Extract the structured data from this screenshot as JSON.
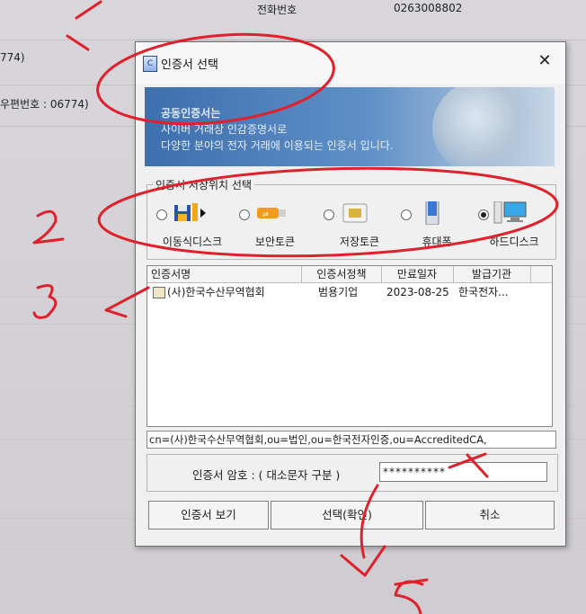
{
  "background": {
    "phone_label": "전화번호",
    "phone_value": "0263008802",
    "left_text_1": "774)",
    "left_text_2": "우편번호 : 06774)"
  },
  "dialog": {
    "title": "인증서 선택",
    "close_glyph": "✕",
    "banner": {
      "title": "공동인증서는",
      "line1": "사이버 거래상 인감증명서로",
      "line2": "다양한 분야의 전자 거래에 이용되는 인증서 입니다."
    },
    "storage_group_label": "인증서 저장위치 선택",
    "storage_options": [
      {
        "label": "이동식디스크",
        "icon": "floppy-usb-icon",
        "selected": false
      },
      {
        "label": "보안토큰",
        "icon": "usb-token-icon",
        "selected": false
      },
      {
        "label": "저장토큰",
        "icon": "sim-card-icon",
        "selected": false
      },
      {
        "label": "휴대폰",
        "icon": "phone-icon",
        "selected": false
      },
      {
        "label": "하드디스크",
        "icon": "computer-icon",
        "selected": true
      }
    ],
    "table": {
      "headers": [
        "인증서명",
        "인증서정책",
        "만료일자",
        "발급기관"
      ],
      "rows": [
        {
          "name": "(사)한국수산무역협회",
          "policy": "범용기업",
          "expiry": "2023-08-25",
          "issuer": "한국전자..."
        }
      ]
    },
    "dn": "cn=(사)한국수산무역협회,ou=법인,ou=한국전자인증,ou=AccreditedCA,",
    "password_label": "인증서 암호 : ( 대소문자 구분 )",
    "password_value": "**********",
    "buttons": {
      "view": "인증서 보기",
      "ok": "선택(확인)",
      "cancel": "취소"
    }
  },
  "annotations": {
    "color": "#e0202a",
    "marks": [
      "1.",
      "2.",
      "3",
      "5."
    ]
  }
}
